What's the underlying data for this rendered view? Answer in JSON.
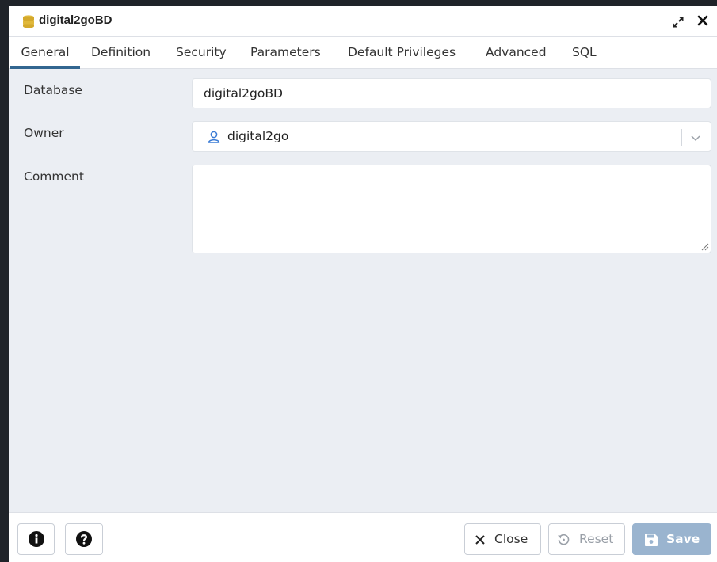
{
  "dialog": {
    "title": "digital2goBD",
    "icons": {
      "title": "database-icon",
      "expand": "expand-icon",
      "close": "close-icon"
    }
  },
  "tabs": [
    {
      "label": "General",
      "active": true
    },
    {
      "label": "Definition",
      "active": false
    },
    {
      "label": "Security",
      "active": false
    },
    {
      "label": "Parameters",
      "active": false
    },
    {
      "label": "Default Privileges",
      "active": false
    },
    {
      "label": "Advanced",
      "active": false
    },
    {
      "label": "SQL",
      "active": false
    }
  ],
  "form": {
    "database": {
      "label": "Database",
      "value": "digital2goBD"
    },
    "owner": {
      "label": "Owner",
      "value": "digital2go",
      "icon": "user-icon"
    },
    "comment": {
      "label": "Comment",
      "value": ""
    }
  },
  "footer": {
    "info_icon": "info-icon",
    "help_icon": "help-icon",
    "close_label": "Close",
    "reset_label": "Reset",
    "save_label": "Save"
  },
  "colors": {
    "accent": "#326690",
    "save_button": "#9ab4cf",
    "panel_bg": "#ebeef3",
    "title_icon": "#e0b83a"
  }
}
